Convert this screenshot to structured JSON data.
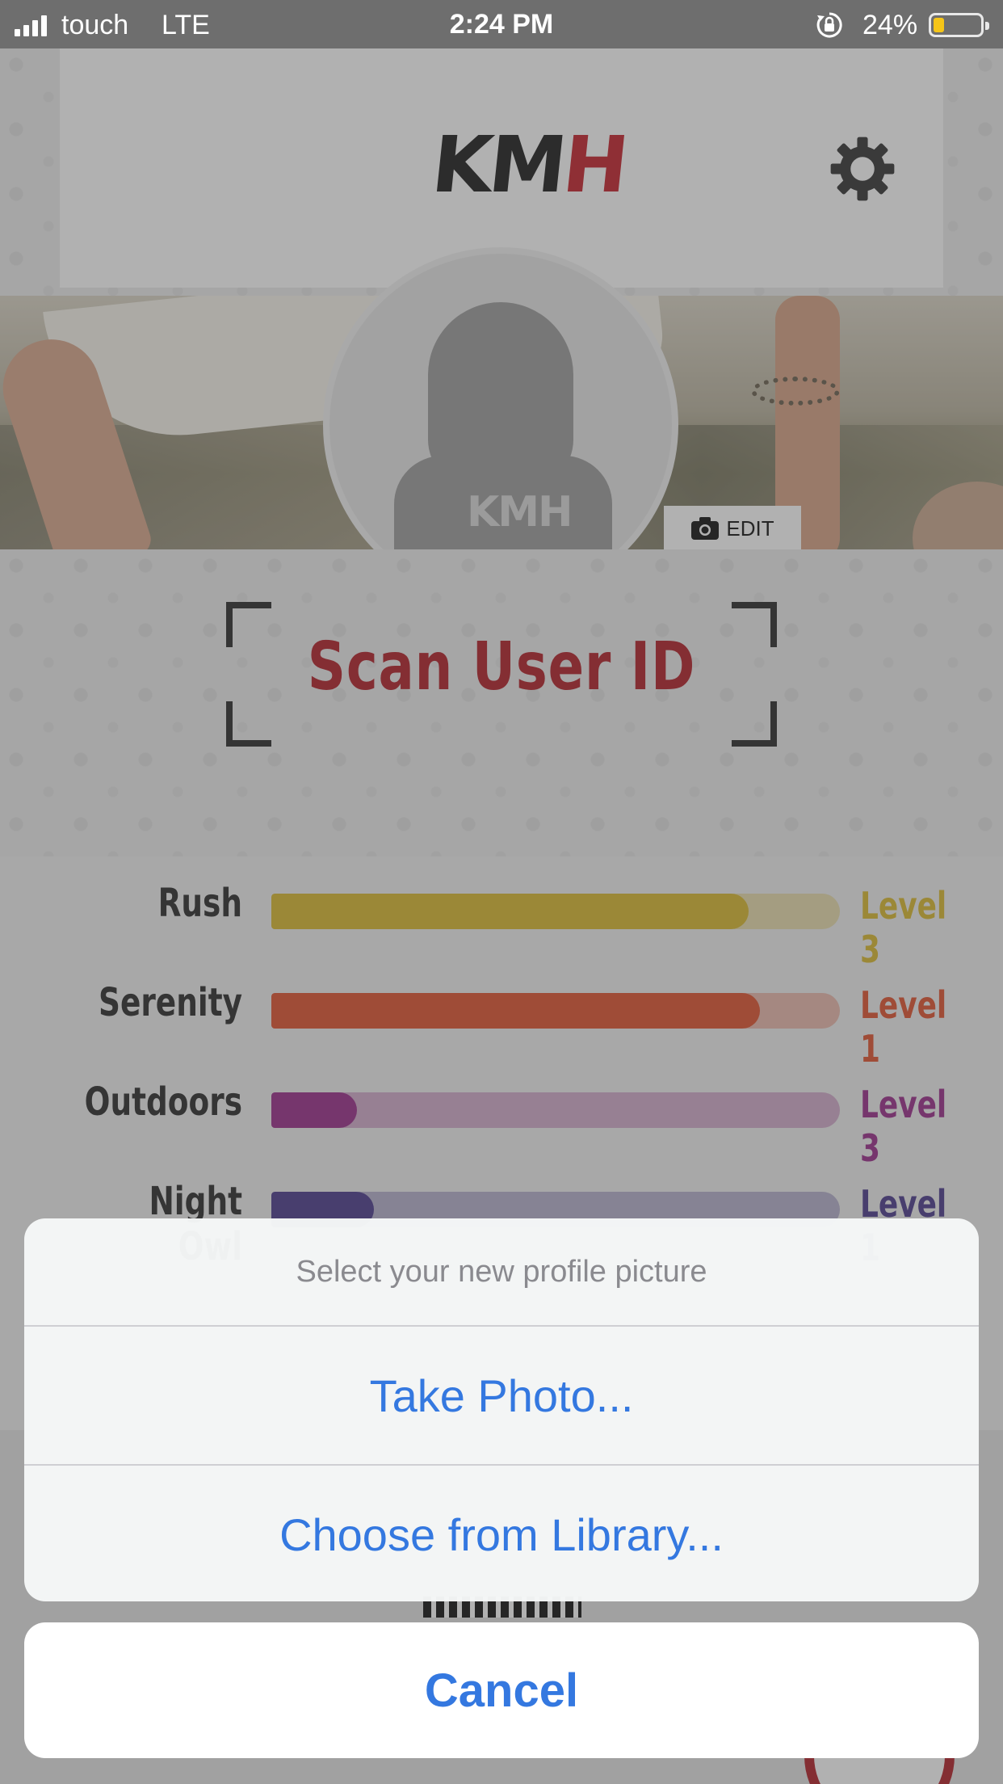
{
  "status_bar": {
    "carrier": "touch",
    "network": "LTE",
    "time": "2:24 PM",
    "battery_percent": "24%",
    "battery_level": 0.24
  },
  "header": {
    "logo_k": "K",
    "logo_m": "M",
    "logo_h": "H",
    "settings_icon": "gear-icon"
  },
  "profile": {
    "edit_label": "EDIT",
    "avatar_mark": "KMH"
  },
  "scan": {
    "label": "Scan User ID"
  },
  "levels": [
    {
      "name": "Rush",
      "value": "Level 3",
      "fill": 0.84,
      "color": "#d9b92e"
    },
    {
      "name": "Serenity",
      "value": "Level 1",
      "fill": 0.86,
      "color": "#e0522e"
    },
    {
      "name": "Outdoors",
      "value": "Level 3",
      "fill": 0.15,
      "color": "#9a2c8a"
    },
    {
      "name": "Night Owl",
      "value": "Level 1",
      "fill": 0.18,
      "color": "#4a3a8c"
    }
  ],
  "action_sheet": {
    "title": "Select your new profile picture",
    "options": [
      "Take Photo...",
      "Choose from Library..."
    ],
    "cancel": "Cancel"
  },
  "colors": {
    "accent": "#3478e0",
    "brand_red": "#b11e26"
  }
}
